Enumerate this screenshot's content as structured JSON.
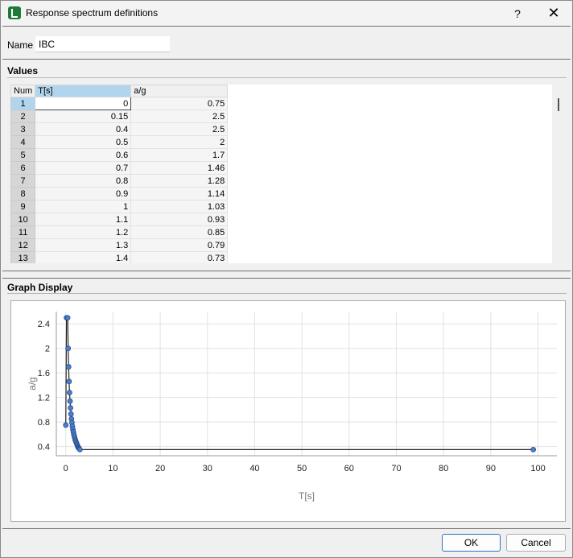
{
  "window": {
    "title": "Response spectrum definitions",
    "help_label": "?",
    "close_label": "✕"
  },
  "name": {
    "label": "Name",
    "value": "IBC"
  },
  "values_section": {
    "title": "Values"
  },
  "table": {
    "columns": [
      "Num",
      "T[s]",
      "a/g"
    ],
    "rows": [
      [
        "1",
        "0",
        "0.75"
      ],
      [
        "2",
        "0.15",
        "2.5"
      ],
      [
        "3",
        "0.4",
        "2.5"
      ],
      [
        "4",
        "0.5",
        "2"
      ],
      [
        "5",
        "0.6",
        "1.7"
      ],
      [
        "6",
        "0.7",
        "1.46"
      ],
      [
        "7",
        "0.8",
        "1.28"
      ],
      [
        "8",
        "0.9",
        "1.14"
      ],
      [
        "9",
        "1",
        "1.03"
      ],
      [
        "10",
        "1.1",
        "0.93"
      ],
      [
        "11",
        "1.2",
        "0.85"
      ],
      [
        "12",
        "1.3",
        "0.79"
      ],
      [
        "13",
        "1.4",
        "0.73"
      ]
    ]
  },
  "graph_section": {
    "title": "Graph Display"
  },
  "chart_data": {
    "type": "line",
    "xlabel": "T[s]",
    "ylabel": "a/g",
    "xlim": [
      -2,
      104
    ],
    "ylim": [
      0.25,
      2.6
    ],
    "xticks": [
      0,
      10,
      20,
      30,
      40,
      50,
      60,
      70,
      80,
      90,
      100
    ],
    "yticks": [
      0.4,
      0.8,
      1.2,
      1.6,
      2,
      2.4
    ],
    "grid": true,
    "series": [
      {
        "color": "#4d7fc9",
        "x": [
          0,
          0.15,
          0.4,
          0.5,
          0.6,
          0.7,
          0.8,
          0.9,
          1,
          1.1,
          1.2,
          1.3,
          1.4,
          1.5,
          1.6,
          1.7,
          1.8,
          1.9,
          2,
          2.1,
          2.2,
          2.3,
          2.4,
          2.5,
          2.6,
          2.7,
          2.8,
          2.9,
          3,
          99
        ],
        "y": [
          0.75,
          2.5,
          2.5,
          2,
          1.7,
          1.46,
          1.28,
          1.14,
          1.03,
          0.93,
          0.85,
          0.79,
          0.73,
          0.68,
          0.64,
          0.6,
          0.57,
          0.54,
          0.51,
          0.49,
          0.47,
          0.45,
          0.43,
          0.41,
          0.39,
          0.38,
          0.37,
          0.36,
          0.35,
          0.35
        ]
      }
    ]
  },
  "buttons": {
    "ok": "OK",
    "cancel": "Cancel"
  }
}
